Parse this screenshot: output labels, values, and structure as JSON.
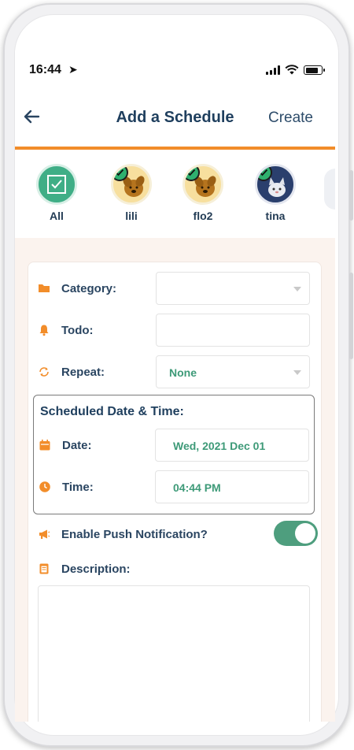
{
  "status_bar": {
    "time": "16:44",
    "location_glyph": "➤"
  },
  "header": {
    "back_icon": "arrow-left-icon",
    "title": "Add a Schedule",
    "action_label": "Create"
  },
  "pets": [
    {
      "name": "All",
      "selected": true
    },
    {
      "name": "lili",
      "selected": true
    },
    {
      "name": "flo2",
      "selected": true
    },
    {
      "name": "tina",
      "selected": true
    }
  ],
  "form": {
    "category": {
      "label": "Category:",
      "value": ""
    },
    "todo": {
      "label": "Todo:",
      "value": ""
    },
    "repeat": {
      "label": "Repeat:",
      "value": "None"
    },
    "schedule": {
      "title": "Scheduled Date & Time:",
      "date": {
        "label": "Date:",
        "value": "Wed, 2021 Dec 01"
      },
      "time": {
        "label": "Time:",
        "value": "04:44 PM"
      }
    },
    "push": {
      "label": "Enable Push Notification?",
      "enabled": true
    },
    "description": {
      "label": "Description:",
      "value": ""
    }
  },
  "colors": {
    "accent": "#f28d2a",
    "primary": "#1f3f5e",
    "green": "#3e9a78",
    "icon_orange": "#f28d2a"
  }
}
